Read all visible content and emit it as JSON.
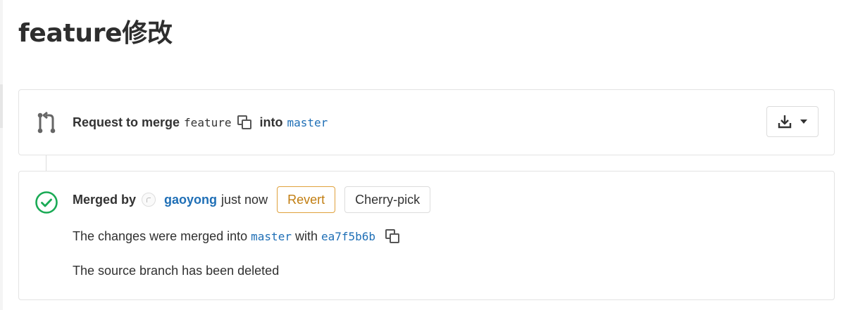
{
  "title": "feature修改",
  "request": {
    "prefix": "Request to merge",
    "source_branch": "feature",
    "middle": "into",
    "target_branch": "master",
    "icons": {
      "merge": "merge-request-icon",
      "copy": "copy-icon",
      "download": "download-icon",
      "caret": "chevron-down-icon"
    }
  },
  "merged": {
    "prefix": "Merged by",
    "user": "gaoyong",
    "time": "just now",
    "revert_label": "Revert",
    "cherry_pick_label": "Cherry-pick",
    "changes_prefix": "The changes were merged into",
    "changes_branch": "master",
    "changes_with": "with",
    "commit_sha": "ea7f5b6b",
    "source_branch_status": "The source branch has been deleted",
    "icons": {
      "status": "check-circle-icon",
      "copy": "copy-icon",
      "avatar": "avatar"
    }
  },
  "colors": {
    "success": "#1aaa55",
    "link": "#1f6fb6",
    "revert": "#c17d10",
    "border": "#e3e3e3"
  }
}
